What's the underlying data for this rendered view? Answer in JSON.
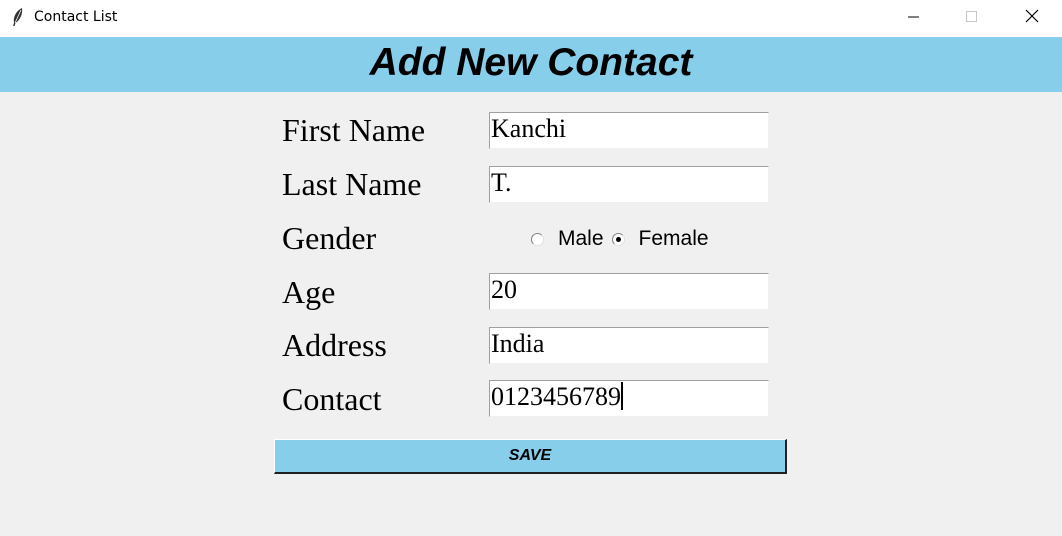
{
  "window": {
    "title": "Contact List",
    "icon": "feather-icon",
    "controls": [
      "minimize-icon",
      "maximize-icon",
      "close-icon"
    ]
  },
  "header": {
    "title": "Add New Contact",
    "background": "#87ceeb"
  },
  "form": {
    "first_name": {
      "label": "First Name",
      "value": "Kanchi"
    },
    "last_name": {
      "label": "Last Name",
      "value": "T."
    },
    "gender": {
      "label": "Gender",
      "options": [
        {
          "label": "Male",
          "selected": false
        },
        {
          "label": "Female",
          "selected": true
        }
      ]
    },
    "age": {
      "label": "Age",
      "value": "20"
    },
    "address": {
      "label": "Address",
      "value": "India"
    },
    "contact": {
      "label": "Contact",
      "value": "0123456789"
    }
  },
  "save_button": {
    "label": "SAVE",
    "background": "#87ceeb"
  }
}
